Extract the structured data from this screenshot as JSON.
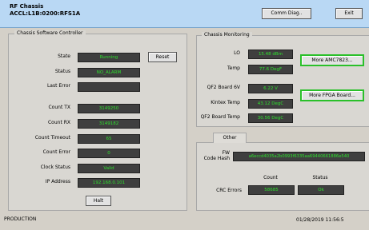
{
  "header": {
    "title": "RF Chassis",
    "subtitle": "ACCL:L1B:0200:RFS1A",
    "comm_diag_label": "Comm Diag..",
    "exit_label": "Exit"
  },
  "software_controller": {
    "title": "Chassis Software Controller",
    "reset_label": "Reset",
    "halt_label": "Halt",
    "fields": [
      {
        "label": "State",
        "value": "Running"
      },
      {
        "label": "Status",
        "value": "NO_ALARM"
      },
      {
        "label": "Last Error",
        "value": ""
      },
      {
        "label": "Count TX",
        "value": "3149250"
      },
      {
        "label": "Count RX",
        "value": "3149182"
      },
      {
        "label": "Count Timeout",
        "value": "65"
      },
      {
        "label": "Count Error",
        "value": "0"
      },
      {
        "label": "Clock Status",
        "value": "Valid"
      },
      {
        "label": "IP Address",
        "value": "192.168.0.101"
      }
    ]
  },
  "monitoring": {
    "title": "Chassis Monitoring",
    "more_amc_label": "More AMC7823...",
    "more_fpga_label": "More FPGA Board...",
    "fields": [
      {
        "label": "LO",
        "value": "15.48 dBm"
      },
      {
        "label": "Temp",
        "value": "77.6 DegF"
      },
      {
        "label": "QF2 Board 6V",
        "value": "6.22 V"
      },
      {
        "label": "Kintex Temp",
        "value": "43.12 DegC"
      },
      {
        "label": "QF2 Board Temp",
        "value": "30.56 DegC"
      }
    ]
  },
  "other": {
    "tab_label": "Other",
    "fw_label_line1": "FW",
    "fw_label_line2": "Code Hash",
    "fw_hash": "a6eccd4035a2b0993f6335aa69440661886e540",
    "col_count": "Count",
    "col_status": "Status",
    "crc_label": "CRC Errors",
    "crc_count": "58685",
    "crc_status": "Ok"
  },
  "footer": {
    "mode": "PRODUCTION",
    "timestamp": "01/28/2019 11:56:5"
  },
  "colors": {
    "value_bg": "#3f3f3f",
    "value_text": "#2ee02e",
    "header_bg": "#b9d8f4",
    "highlight_border": "#2ac02a"
  }
}
